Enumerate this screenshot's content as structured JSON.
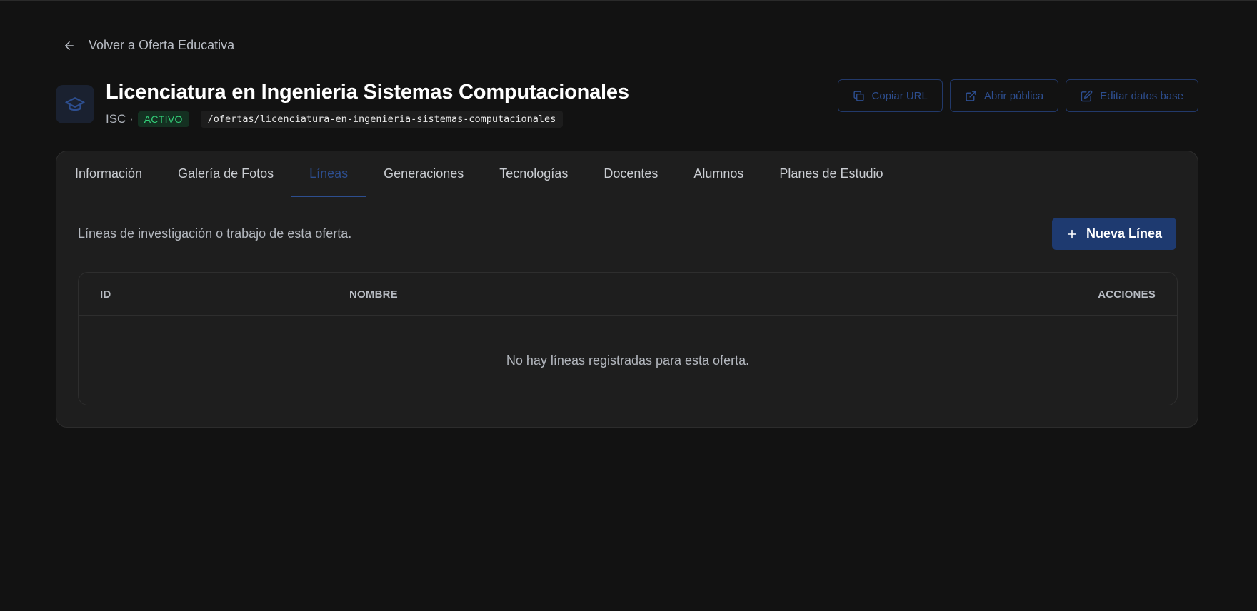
{
  "back": {
    "label": "Volver a Oferta Educativa"
  },
  "header": {
    "title": "Licenciatura en Ingenieria Sistemas Computacionales",
    "code": "ISC ·",
    "status": "ACTIVO",
    "slug": "/ofertas/licenciatura-en-ingenieria-sistemas-computacionales",
    "icon": "graduation-cap-icon"
  },
  "actions": {
    "copy_url": "Copiar URL",
    "open_public": "Abrir pública",
    "edit_base": "Editar datos base"
  },
  "tabs": [
    {
      "label": "Información"
    },
    {
      "label": "Galería de Fotos"
    },
    {
      "label": "Líneas",
      "active": true
    },
    {
      "label": "Generaciones"
    },
    {
      "label": "Tecnologías"
    },
    {
      "label": "Docentes"
    },
    {
      "label": "Alumnos"
    },
    {
      "label": "Planes de Estudio"
    }
  ],
  "section": {
    "description": "Líneas de investigación o trabajo de esta oferta.",
    "new_button": "Nueva Línea"
  },
  "table": {
    "columns": [
      "ID",
      "NOMBRE",
      "ACCIONES"
    ],
    "empty_message": "No hay líneas registradas para esta oferta."
  },
  "colors": {
    "background": "#121212",
    "card": "#1e1e1e",
    "accent": "#2d4e8f",
    "primary_button": "#1e3a70",
    "status_green": "#34d27a"
  }
}
